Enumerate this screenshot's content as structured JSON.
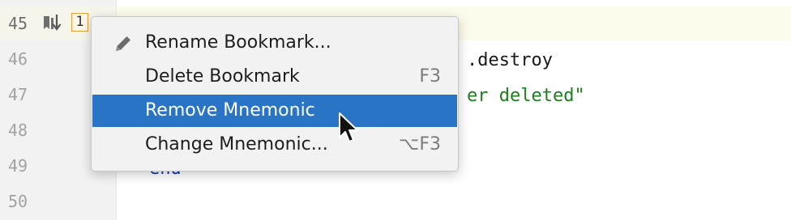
{
  "gutter": {
    "line_numbers": [
      "45",
      "46",
      "47",
      "48",
      "49",
      "50"
    ],
    "current_line": "45",
    "mnemonic": "1",
    "bookmark_icon": "bookmark-sort-icon"
  },
  "code": {
    "line46": ".destroy",
    "line47": "er deleted\"",
    "line49": "end"
  },
  "menu": {
    "items": [
      {
        "label": "Rename Bookmark...",
        "shortcut": "",
        "icon": "pencil-icon"
      },
      {
        "label": "Delete Bookmark",
        "shortcut": "F3",
        "icon": ""
      },
      {
        "label": "Remove Mnemonic",
        "shortcut": "",
        "icon": "",
        "selected": true
      },
      {
        "label": "Change Mnemonic...",
        "shortcut": "⌥F3",
        "icon": ""
      }
    ]
  },
  "colors": {
    "selection": "#2a74c6",
    "mnemonic_border": "#e5a13a",
    "string": "#1b7f1b",
    "keyword": "#0b3aa6"
  }
}
